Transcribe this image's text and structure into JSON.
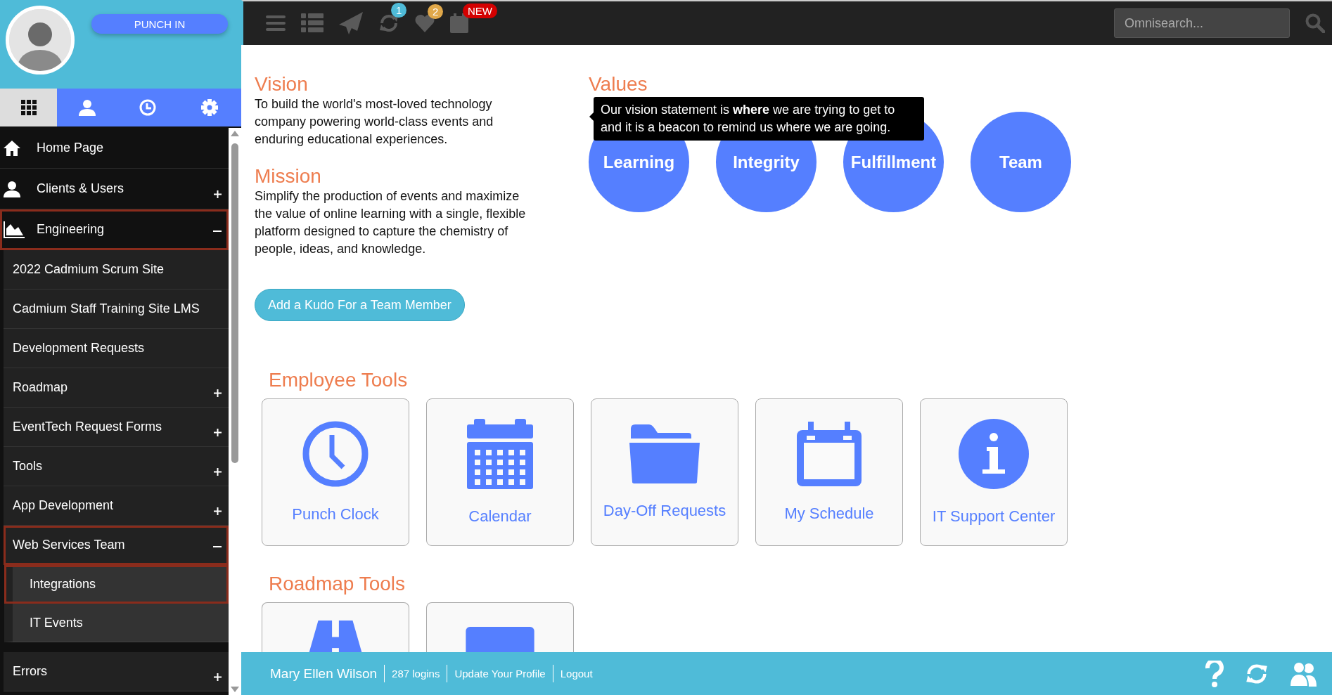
{
  "sidebar": {
    "punch_button": "PUNCH IN",
    "tabs": [
      {
        "selected": true
      },
      {
        "selected": false
      },
      {
        "selected": false
      },
      {
        "selected": false
      }
    ],
    "nav": [
      {
        "label": "Home Page",
        "selected": false
      },
      {
        "label": "Clients & Users",
        "expanded": false,
        "selected": false
      },
      {
        "label": "Engineering",
        "expanded": true,
        "selected": true,
        "children": [
          {
            "label": "2022 Cadmium Scrum Site",
            "selected": false
          },
          {
            "label": "Cadmium Staff Training Site LMS",
            "selected": false
          },
          {
            "label": "Development Requests",
            "selected": false
          },
          {
            "label": "Roadmap",
            "expanded": false,
            "selected": false
          },
          {
            "label": "EventTech Request Forms",
            "expanded": false,
            "selected": false
          },
          {
            "label": "Tools",
            "expanded": false,
            "selected": false
          },
          {
            "label": "App Development",
            "expanded": false,
            "selected": false
          },
          {
            "label": "Web Services Team",
            "expanded": true,
            "selected": true,
            "children": [
              {
                "label": "Integrations",
                "selected": true
              },
              {
                "label": "IT Events",
                "selected": false
              }
            ]
          },
          {
            "label": "Errors",
            "expanded": false,
            "selected": false
          }
        ]
      }
    ]
  },
  "toolbar": [
    {
      "kind": "menu"
    },
    {
      "kind": "list"
    },
    {
      "kind": "send"
    },
    {
      "kind": "sync",
      "badge": "1",
      "color": "#4fbbd8"
    },
    {
      "kind": "heart",
      "badge": "2",
      "color": "#e0a84a"
    },
    {
      "kind": "calendar",
      "badge": "NEW",
      "color": "#d40000"
    }
  ],
  "search": {
    "placeholder": "Omnisearch..."
  },
  "vision": {
    "title": "Vision",
    "text": "To build the world's most-loved technology company powering world-class events and enduring educational experiences."
  },
  "mission": {
    "title": "Mission",
    "text": "Simplify the production of events and maximize the value of online learning with a single, flexible platform designed to capture the chemistry of people, ideas, and knowledge."
  },
  "kudo_button": "Add a Kudo For a Team Member",
  "values": {
    "title": "Values",
    "tooltip": "Our vision statement is **where** we are trying to get to and it is a beacon to remind us where we are going.",
    "items": [
      "Learning",
      "Integrity",
      "Fulfillment",
      "Team"
    ]
  },
  "employee_tools": {
    "title": "Employee Tools",
    "cards": [
      {
        "kind": "clock",
        "label": "Punch Clock"
      },
      {
        "kind": "calendar",
        "label": "Calendar"
      },
      {
        "kind": "folder",
        "label": "Day-Off Requests"
      },
      {
        "kind": "schedule",
        "label": "My Schedule"
      },
      {
        "kind": "info",
        "label": "IT Support Center"
      }
    ]
  },
  "roadmap_tools": {
    "title": "Roadmap Tools",
    "cards": [
      {
        "kind": "road"
      },
      {
        "kind": "panel"
      }
    ]
  },
  "footer": {
    "user": "Mary Ellen Wilson",
    "logins": "287 logins",
    "links": [
      "Update Your Profile",
      "Logout"
    ]
  }
}
